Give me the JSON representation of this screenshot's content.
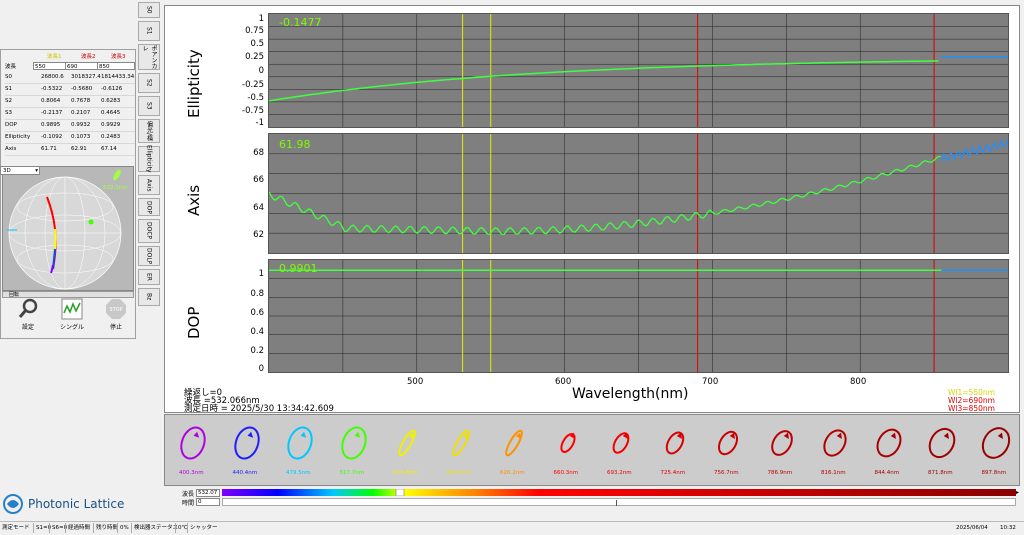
{
  "left_panel": {
    "columns": [
      {
        "header": "波長1",
        "color": "#c8c800"
      },
      {
        "header": "波長2",
        "color": "#d00000"
      },
      {
        "header": "波長3",
        "color": "#d00000"
      }
    ],
    "wavelength_label": "波長",
    "wavelength_inputs": [
      "550",
      "690",
      "850"
    ],
    "rows": [
      {
        "label": "S0",
        "v1": "26800.6",
        "v2": "3018327.4",
        "v3": "1814433.34"
      },
      {
        "label": "S1",
        "v1": "-0.5322",
        "v2": "-0.5680",
        "v3": "-0.6126"
      },
      {
        "label": "S2",
        "v1": "0.8064",
        "v2": "0.7678",
        "v3": "0.6283"
      },
      {
        "label": "S3",
        "v1": "-0.2137",
        "v2": "0.2107",
        "v3": "0.4645"
      },
      {
        "label": "DOP",
        "v1": "0.9895",
        "v2": "0.9932",
        "v3": "0.9929"
      },
      {
        "label": "Ellipticity",
        "v1": "-0.1092",
        "v2": "0.1073",
        "v3": "0.2483"
      },
      {
        "label": "Axis",
        "v1": "61.71",
        "v2": "62.91",
        "v3": "67.14"
      }
    ],
    "mode_select": "3D",
    "sphere_label": "532.1nm",
    "rotate_label": "回転",
    "buttons": {
      "settings": "設定",
      "single": "シングル",
      "stop": "停止",
      "stop_icon": "STOP"
    }
  },
  "vtabs": [
    "S0",
    "S1",
    "ポアンカレ",
    "S2",
    "S3",
    "偏光/楕",
    "Ellipticity",
    "Axis",
    "DOP",
    "DOCP",
    "DOLP",
    "ER",
    "Bz"
  ],
  "plots": {
    "ellipticity": {
      "label": "Ellipticity",
      "value": "-0.1477",
      "yticks": [
        "1",
        "0.75",
        "0.5",
        "0.25",
        "0",
        "-0.25",
        "-0.5",
        "-0.75",
        "-1"
      ]
    },
    "axis": {
      "label": "Axis",
      "value": "61.98",
      "yticks": [
        "68",
        "66",
        "64",
        "62"
      ]
    },
    "dop": {
      "label": "DOP",
      "value": "0.9901",
      "yticks": [
        "1",
        "0.8",
        "0.6",
        "0.4",
        "0.2",
        "0"
      ]
    }
  },
  "x_axis": {
    "label": "Wavelength(nm)",
    "ticks": [
      "500",
      "600",
      "700",
      "800"
    ]
  },
  "info": {
    "repeat": "繰返し=0",
    "wavelength": "波長 =532.066nm",
    "datetime": "測定日時 = 2025/5/30 13:34:42.609"
  },
  "wl_legend": [
    {
      "text": "Wl1=550nm",
      "color": "#d8d800"
    },
    {
      "text": "Wl2=690nm",
      "color": "#e00000"
    },
    {
      "text": "Wl3=850nm",
      "color": "#e00000"
    }
  ],
  "ellipses": [
    {
      "label": "400.3nm",
      "color": "#b000e0"
    },
    {
      "label": "440.4nm",
      "color": "#1e1eff"
    },
    {
      "label": "479.5nm",
      "color": "#00c8ff"
    },
    {
      "label": "517.7nm",
      "color": "#40ff00"
    },
    {
      "label": "554.8nm",
      "color": "#f0f000"
    },
    {
      "label": "591.0nm",
      "color": "#f0e000"
    },
    {
      "label": "626.2nm",
      "color": "#ff9000"
    },
    {
      "label": "660.3nm",
      "color": "#ff0000"
    },
    {
      "label": "693.2nm",
      "color": "#ee0000"
    },
    {
      "label": "725.4nm",
      "color": "#d80000"
    },
    {
      "label": "756.7nm",
      "color": "#c80000"
    },
    {
      "label": "786.9nm",
      "color": "#b80000"
    },
    {
      "label": "816.1nm",
      "color": "#b00000"
    },
    {
      "label": "844.4nm",
      "color": "#a80000"
    },
    {
      "label": "871.8nm",
      "color": "#a00000"
    },
    {
      "label": "897.8nm",
      "color": "#980000"
    }
  ],
  "logo": {
    "text": "Photonic Lattice"
  },
  "bottom": {
    "wavelength_label": "波長",
    "wavelength_value": "532.07",
    "time_label": "時間",
    "time_value": "0"
  },
  "status": {
    "items": [
      "測定モード",
      "S1=0",
      "S6=0",
      "経過時間",
      "残り時間",
      "0%",
      "検出器ステータス",
      "0℃",
      "シャッター"
    ],
    "date": "2025/06/04",
    "time": "10:32"
  }
}
